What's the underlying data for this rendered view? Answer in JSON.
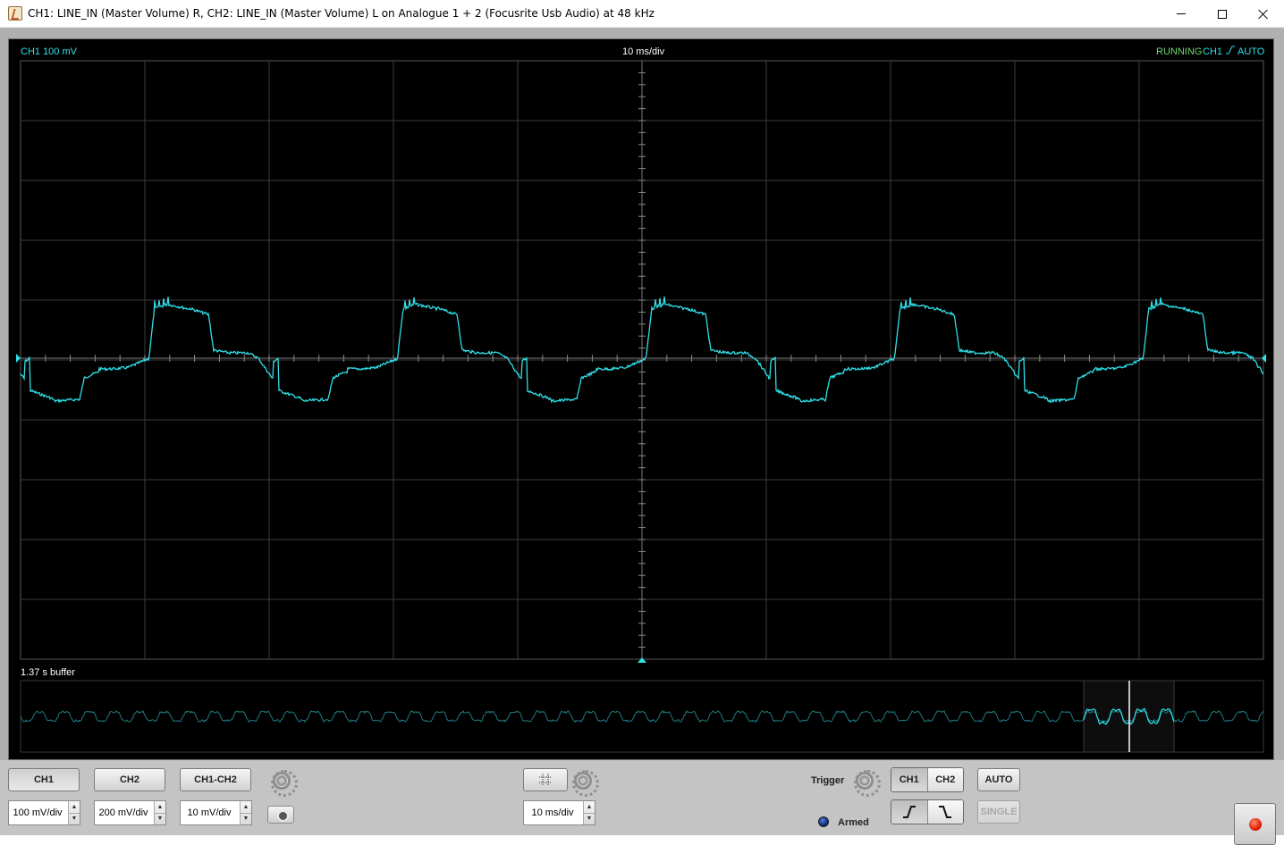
{
  "window": {
    "title": "CH1: LINE_IN (Master Volume) R, CH2: LINE_IN (Master Volume) L on Analogue 1 + 2 (Focusrite Usb Audio) at 48 kHz"
  },
  "scope": {
    "ch1_scale_readout": "CH1 100 mV",
    "timebase_readout": "10 ms/div",
    "status": "RUNNING",
    "trigger_channel_readout": "CH1",
    "trigger_mode_readout": "AUTO",
    "trace_color": "#2fe0e8",
    "status_color": "#6fd86f",
    "buffer_label": "1.37 s buffer"
  },
  "controls": {
    "ch1_label": "CH1",
    "ch2_label": "CH2",
    "ch1_minus_ch2_label": "CH1-CH2",
    "ch1_scale": "100 mV/div",
    "ch2_scale": "200 mV/div",
    "diff_scale": "10 mV/div",
    "timebase": "10 ms/div",
    "trigger_label": "Trigger",
    "trigger_ch1": "CH1",
    "trigger_ch2": "CH2",
    "auto_label": "AUTO",
    "single_label": "SINGLE",
    "armed_label": "Armed"
  }
}
